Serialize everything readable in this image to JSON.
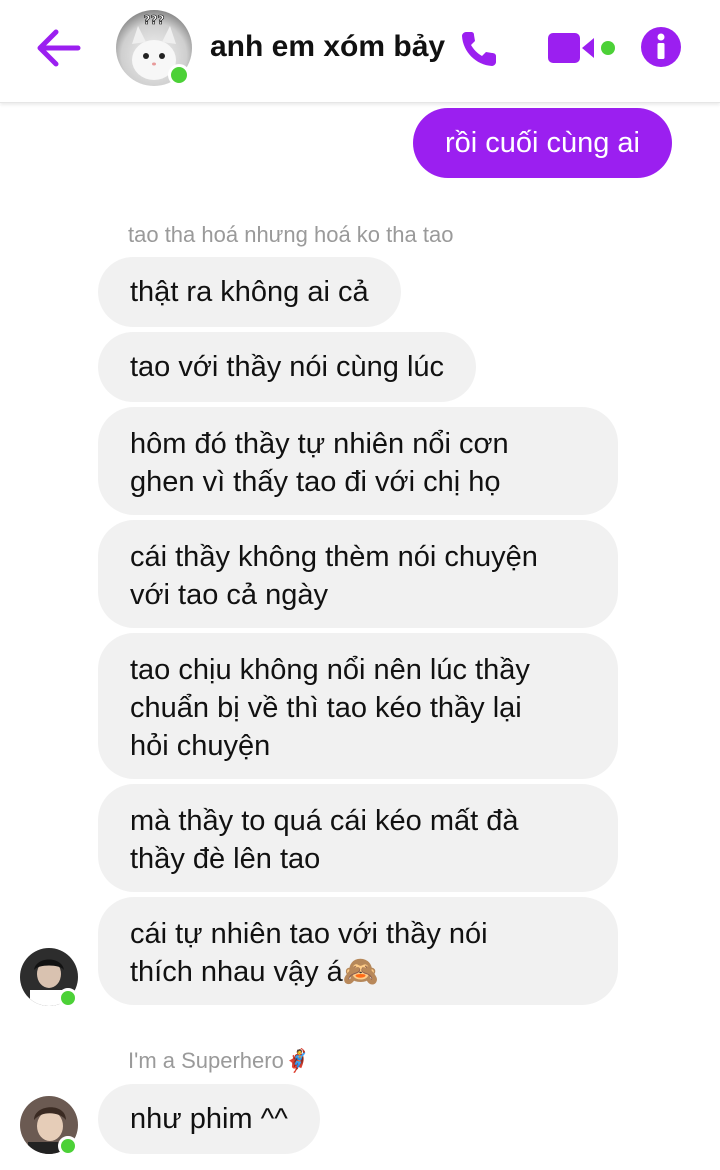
{
  "header": {
    "title": "anh em xóm bảy",
    "avatar_badge": "???",
    "accent_color": "#9b1ff0",
    "online_color": "#4cd137"
  },
  "messages": {
    "outgoing": {
      "text": "rồi cuối cùng ai"
    },
    "group1": {
      "sender": "tao tha hoá nhưng hoá ko tha tao",
      "bubbles": [
        "thật ra không ai cả",
        "tao với thầy nói cùng lúc",
        "hôm đó thầy tự nhiên nổi cơn\nghen vì thấy tao đi với chị họ",
        "cái thầy không thèm nói chuyện\nvới tao cả ngày",
        "tao chịu không nổi nên lúc thầy\nchuẩn bị về thì tao kéo thầy lại\nhỏi chuyện",
        "mà thầy to quá cái kéo mất đà\nthầy đè lên tao",
        "cái tự nhiên tao với thầy nói\nthích nhau vậy á🙈"
      ]
    },
    "group2": {
      "sender": "I'm a Superhero🦸",
      "bubbles": [
        "như phim ^^"
      ]
    }
  },
  "icons": {
    "back": "arrow-left-icon",
    "phone": "phone-icon",
    "video": "video-camera-icon",
    "info": "info-icon"
  }
}
